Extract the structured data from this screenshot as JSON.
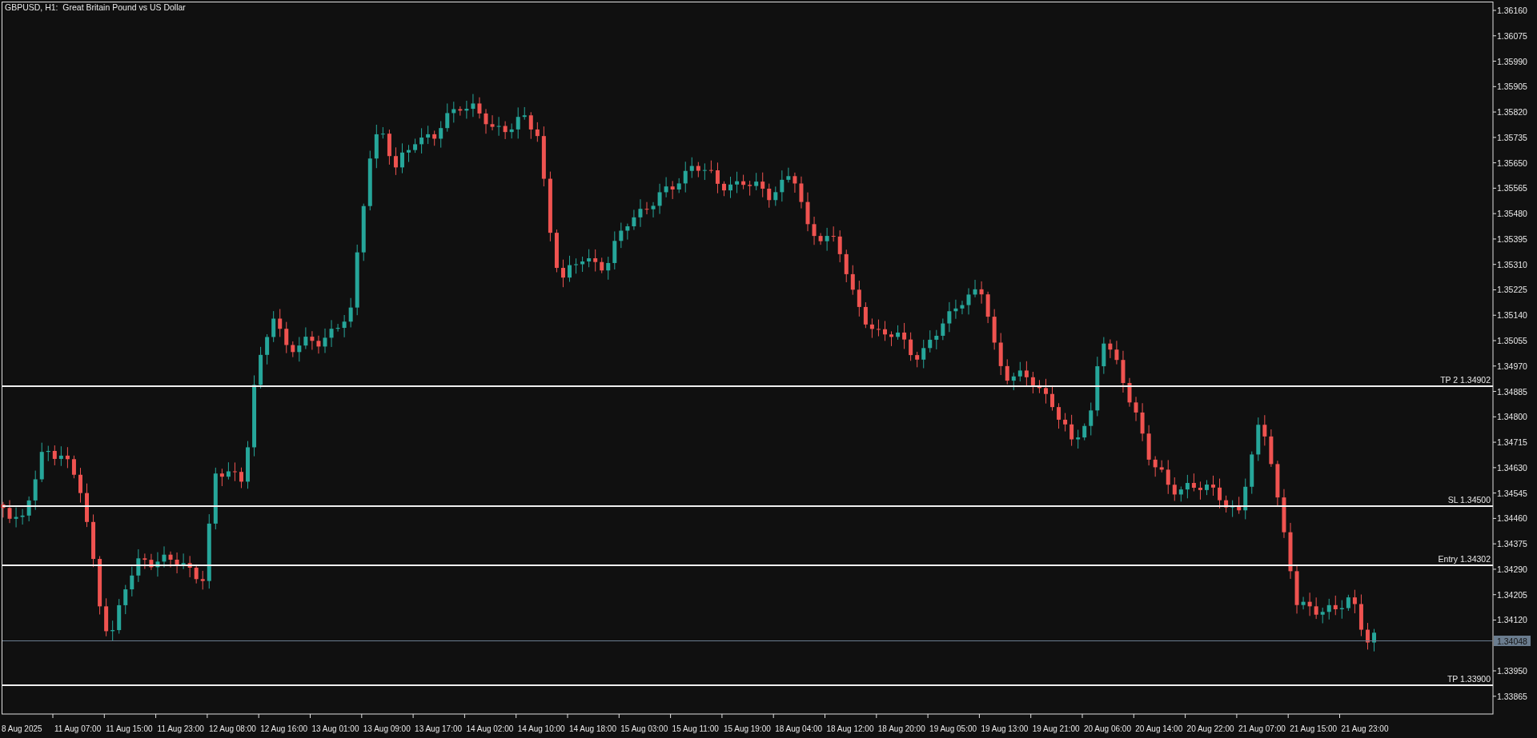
{
  "chart": {
    "header": "GBPUSD, H1:  Great Britain Pound vs US Dollar",
    "price_axis": [
      "1.36160",
      "1.36075",
      "1.35990",
      "1.35905",
      "1.35820",
      "1.35735",
      "1.35650",
      "1.35565",
      "1.35480",
      "1.35395",
      "1.35310",
      "1.35225",
      "1.35140",
      "1.35055",
      "1.34970",
      "1.34885",
      "1.34800",
      "1.34715",
      "1.34630",
      "1.34545",
      "1.34460",
      "1.34375",
      "1.34290",
      "1.34205",
      "1.34120",
      "1.33950",
      "1.33865"
    ],
    "time_axis": [
      "8 Aug 2025",
      "11 Aug 07:00",
      "11 Aug 15:00",
      "11 Aug 23:00",
      "12 Aug 08:00",
      "12 Aug 16:00",
      "13 Aug 01:00",
      "13 Aug 09:00",
      "13 Aug 17:00",
      "14 Aug 02:00",
      "14 Aug 10:00",
      "14 Aug 18:00",
      "15 Aug 03:00",
      "15 Aug 11:00",
      "15 Aug 19:00",
      "18 Aug 04:00",
      "18 Aug 12:00",
      "18 Aug 20:00",
      "19 Aug 05:00",
      "19 Aug 13:00",
      "19 Aug 21:00",
      "20 Aug 06:00",
      "20 Aug 14:00",
      "20 Aug 22:00",
      "21 Aug 07:00",
      "21 Aug 15:00",
      "21 Aug 23:00"
    ],
    "levels": [
      {
        "label": "TP 2 1.34902"
      },
      {
        "label": "SL 1.34500"
      },
      {
        "label": "Entry 1.34302"
      },
      {
        "label": "TP 1.33900"
      }
    ],
    "current_price": "1.34048"
  }
}
